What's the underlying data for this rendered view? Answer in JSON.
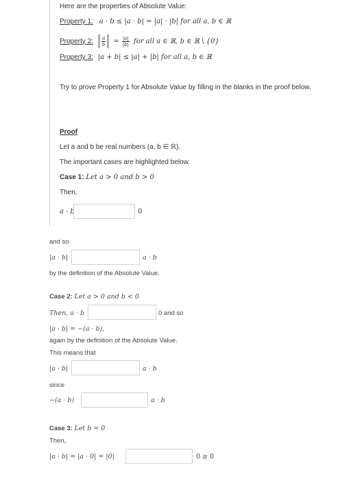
{
  "intro": "Here are the properties of Absolute Value:",
  "properties": [
    {
      "label": "Property 1:",
      "statement": "a · b ≤ |a · b| = |a| · |b| for all a, b ∈ ℝ"
    },
    {
      "label": "Property 2:",
      "frac_left_num": "a",
      "frac_left_den": "b",
      "frac_right_num": "|a|",
      "frac_right_den": "|b|",
      "equals": "=",
      "statement": "for all a ∈ ℝ,  b ∈ ℝ \\ {0}"
    },
    {
      "label": "Property 3:",
      "statement": "|a + b| ≤ |a| + |b|  for all a, b ∈ ℝ"
    }
  ],
  "instruction": "Try to prove Property 1 for Absolute Value by filling in the blanks in the proof below.",
  "proof": {
    "heading": "Proof",
    "let": "Let a and b be real numbers (a, b ∈ ℝ).",
    "important": "The important cases are highlighted below.",
    "case1_label": "Case 1:",
    "case1_text": "Let a > 0 and b > 0",
    "then": "Then,",
    "ab": "a · b",
    "zero": "0"
  },
  "lower": {
    "and_so": "and so",
    "abs_ab": "|a · b|",
    "ab": "a · b",
    "by_def": "by the definition of the Absolute Value.",
    "case2_label": "Case 2:",
    "case2_text": "Let a > 0 and b < 0",
    "then_ab": "Then, a · b",
    "zero_and_so": "0 and so",
    "abs_eq_neg": "|a · b| = −(a · b),",
    "again": "again by the definition of the Absolute Value.",
    "this_means": "This means that",
    "abs_ab2": "|a · b|",
    "ab2": "a · b",
    "since": "since",
    "neg_ab": "−(a · b)",
    "ab3": "a · b",
    "case3_label": "Case 3:",
    "case3_text": "Let b = 0",
    "then3": "Then,",
    "chain": "|a · b| = |a · 0| = |0|",
    "zero_ge_zero": "0 ≥ 0"
  }
}
